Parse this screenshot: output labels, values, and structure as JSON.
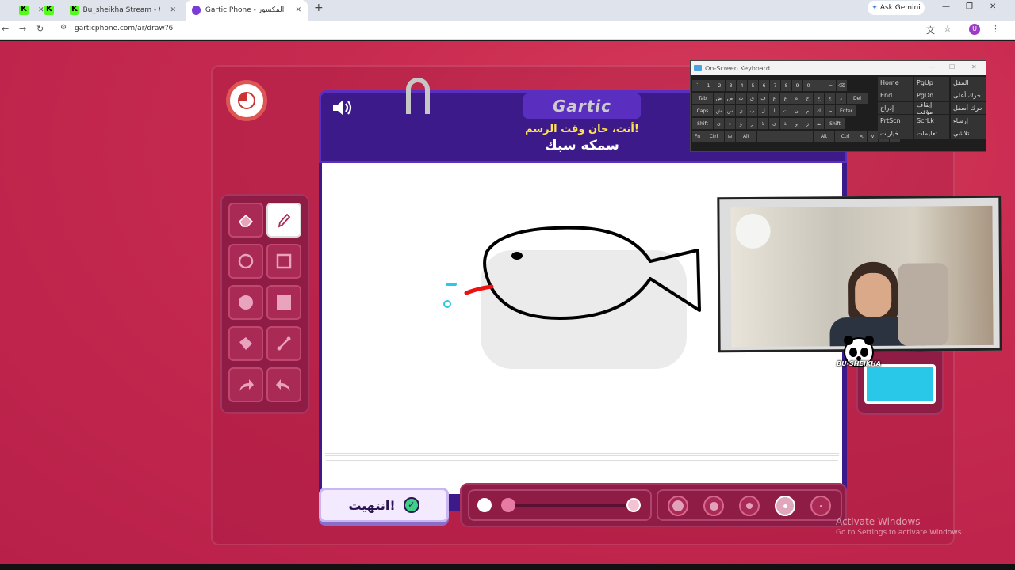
{
  "browser": {
    "tabs": [
      {
        "title": "",
        "icon": "kick-icon"
      },
      {
        "title": "",
        "icon": "kick-icon"
      },
      {
        "title": "Bu_sheikha Stream - Watch Live",
        "icon": "kick-icon"
      },
      {
        "title": "Gartic Phone - الهاتف المكسور",
        "icon": "gartic-icon"
      }
    ],
    "ask_gemini": "Ask Gemini",
    "url": "garticphone.com/ar/draw?6",
    "profile_initial": "U"
  },
  "game": {
    "logo": "Gartic",
    "prompt": "أنت، حان وقت الرسم!",
    "word": "سمكه سبك",
    "done_button": "انتهيت!",
    "current_color": "#29c8e8",
    "brush_size_selected": 4
  },
  "keyboard": {
    "title": "On-Screen Keyboard",
    "rows": [
      [
        "`",
        "1",
        "2",
        "3",
        "4",
        "5",
        "6",
        "7",
        "8",
        "9",
        "0",
        "-",
        "=",
        "⌫"
      ],
      [
        "Tab",
        "ض",
        "ص",
        "ث",
        "ق",
        "ف",
        "غ",
        "ع",
        "ه",
        "خ",
        "ح",
        "ج",
        "د",
        "Del"
      ],
      [
        "Caps",
        "ش",
        "س",
        "ي",
        "ب",
        "ل",
        "ا",
        "ت",
        "ن",
        "م",
        "ك",
        "ط",
        "Enter"
      ],
      [
        "Shift",
        "ئ",
        "ء",
        "ؤ",
        "ر",
        "لا",
        "ى",
        "ة",
        "و",
        "ز",
        "ظ",
        "Shift"
      ],
      [
        "Fn",
        "Ctrl",
        "⊞",
        "Alt",
        "",
        "Alt",
        "Ctrl",
        "<",
        "v",
        ">",
        "▤"
      ]
    ],
    "side_cols": [
      [
        "Home",
        "PgUp",
        "التنقل"
      ],
      [
        "End",
        "PgDn",
        "حرك أعلى"
      ],
      [
        "إدراج",
        "إيقاف مؤقت",
        "حرك أسفل"
      ],
      [
        "PrtScn",
        "ScrLk",
        "إرساء"
      ],
      [
        "خيارات",
        "تعليمات",
        "تلاشي"
      ]
    ]
  },
  "stream": {
    "logo_text": "BU-SHEIKHA"
  },
  "watermark": {
    "line1": "Activate Windows",
    "line2": "Go to Settings to activate Windows."
  }
}
